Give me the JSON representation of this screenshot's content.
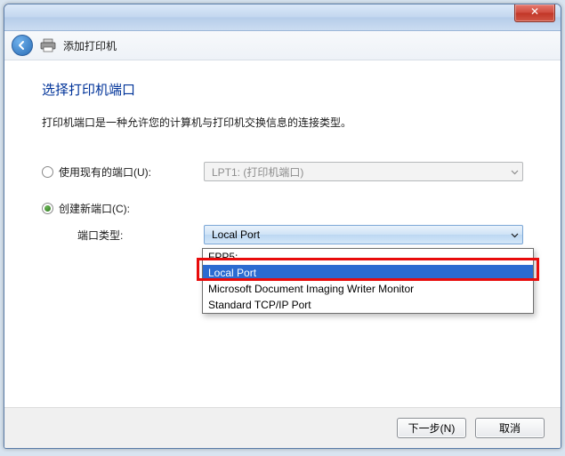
{
  "titlebar": {
    "close_symbol": "✕"
  },
  "header": {
    "title": "添加打印机"
  },
  "main": {
    "page_title": "选择打印机端口",
    "description": "打印机端口是一种允许您的计算机与打印机交换信息的连接类型。",
    "existing_port": {
      "label": "使用现有的端口(U):",
      "value": "LPT1: (打印机端口)",
      "checked": false
    },
    "new_port": {
      "label": "创建新端口(C):",
      "checked": true
    },
    "port_type": {
      "label": "端口类型:",
      "selected": "Local Port",
      "options": [
        "FPP5:",
        "Local Port",
        "Microsoft Document Imaging Writer Monitor",
        "Standard TCP/IP Port"
      ],
      "highlighted_index": 1
    }
  },
  "footer": {
    "next": "下一步(N)",
    "cancel": "取消"
  }
}
